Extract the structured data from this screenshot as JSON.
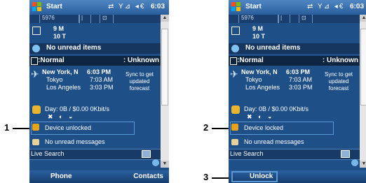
{
  "callouts": {
    "one": "1",
    "two": "2",
    "three": "3"
  },
  "screens": [
    {
      "title": "Start",
      "clock": "6:03",
      "status_icons": "⇄ Y⊿ ◂€",
      "calendar_strip": [
        "5976",
        "|",
        "⊡"
      ],
      "weather": {
        "line1": "9 M",
        "line2": "10 T"
      },
      "unread": "No unread items",
      "profile_left": "Normal",
      "profile_right": ": Unknown",
      "world_clock": {
        "city1": "New York, N",
        "time1": "6:03 PM",
        "city2": "Tokyo",
        "time2": "7:03 AM",
        "city3": "Los Angeles",
        "time3": "3:03 PM",
        "sync_note": "Sync to get updated forecast"
      },
      "connection": "Day: 0B / $0.00  0Kbit/s",
      "lock_status": "Device unlocked",
      "messages": "No unread messages",
      "search": "Live Search",
      "softkeys": {
        "left": "Phone",
        "right": "Contacts"
      }
    },
    {
      "title": "Start",
      "clock": "6:03",
      "status_icons": "⇄ Y⊿ ◂€",
      "calendar_strip": [
        "5976",
        "|",
        "⊡"
      ],
      "weather": {
        "line1": "9 M",
        "line2": "10 T"
      },
      "unread": "No unread items",
      "profile_left": "Normal",
      "profile_right": ": Unknown",
      "world_clock": {
        "city1": "New York, N",
        "time1": "6:03 PM",
        "city2": "Tokyo",
        "time2": "7:03 AM",
        "city3": "Los Angeles",
        "time3": "3:03 PM",
        "sync_note": "Sync to get updated forecast"
      },
      "connection": "Day: 0B / $0.00  0Kbit/s",
      "lock_status": "Device locked",
      "messages": "No unread messages",
      "search": "Live Search",
      "softkeys": {
        "left": "Unlock",
        "right": ""
      }
    }
  ]
}
